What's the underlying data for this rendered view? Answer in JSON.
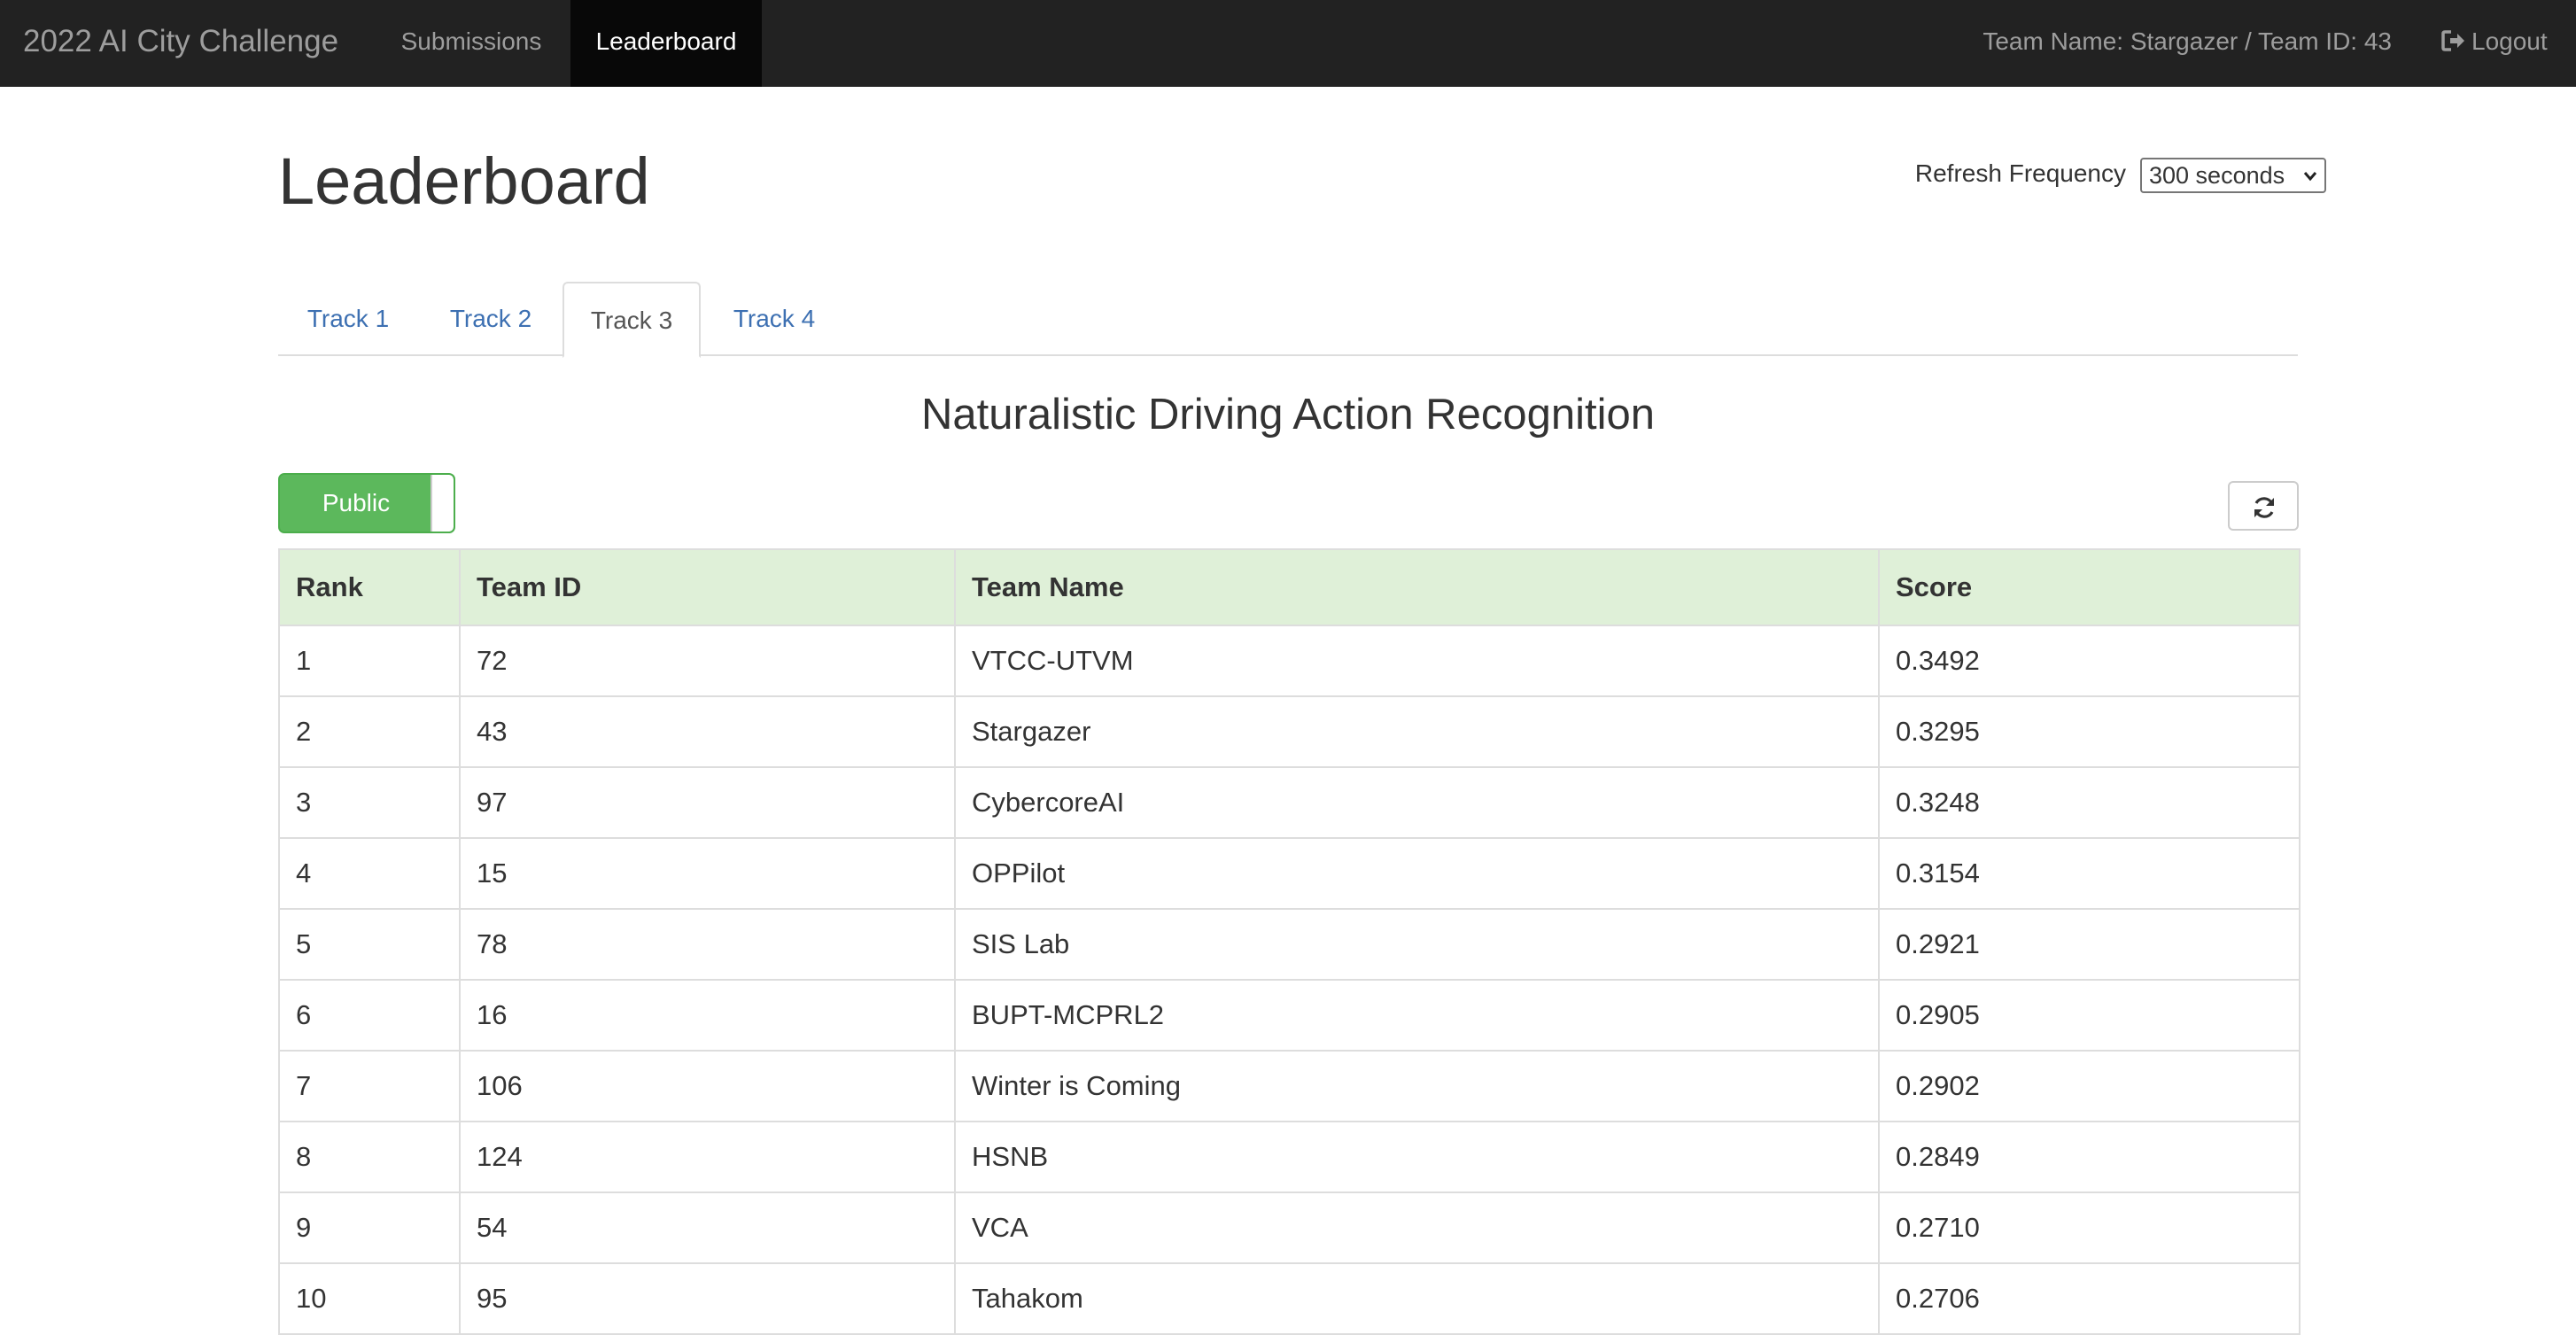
{
  "navbar": {
    "brand": "2022 AI City Challenge",
    "links": [
      {
        "label": "Submissions",
        "active": false
      },
      {
        "label": "Leaderboard",
        "active": true
      }
    ],
    "team_info": "Team Name: Stargazer / Team ID: 43",
    "logout_label": "Logout",
    "logout_icon": "logout-icon"
  },
  "page": {
    "title": "Leaderboard",
    "refresh_label": "Refresh Frequency",
    "refresh_value": "300 seconds"
  },
  "tabs": [
    {
      "label": "Track 1",
      "active": false
    },
    {
      "label": "Track 2",
      "active": false
    },
    {
      "label": "Track 3",
      "active": true
    },
    {
      "label": "Track 4",
      "active": false
    }
  ],
  "section": {
    "title": "Naturalistic Driving Action Recognition",
    "toggle_label": "Public",
    "refresh_icon": "refresh-icon"
  },
  "table": {
    "headers": [
      "Rank",
      "Team ID",
      "Team Name",
      "Score"
    ],
    "rows": [
      [
        "1",
        "72",
        "VTCC-UTVM",
        "0.3492"
      ],
      [
        "2",
        "43",
        "Stargazer",
        "0.3295"
      ],
      [
        "3",
        "97",
        "CybercoreAI",
        "0.3248"
      ],
      [
        "4",
        "15",
        "OPPilot",
        "0.3154"
      ],
      [
        "5",
        "78",
        "SIS Lab",
        "0.2921"
      ],
      [
        "6",
        "16",
        "BUPT-MCPRL2",
        "0.2905"
      ],
      [
        "7",
        "106",
        "Winter is Coming",
        "0.2902"
      ],
      [
        "8",
        "124",
        "HSNB",
        "0.2849"
      ],
      [
        "9",
        "54",
        "VCA",
        "0.2710"
      ],
      [
        "10",
        "95",
        "Tahakom",
        "0.2706"
      ]
    ]
  },
  "colors": {
    "navbar_bg": "#222222",
    "active_nav_bg": "#080808",
    "tab_link": "#3d70b2",
    "toggle_on": "#5cb85c",
    "table_header_bg": "#dff0d8"
  }
}
